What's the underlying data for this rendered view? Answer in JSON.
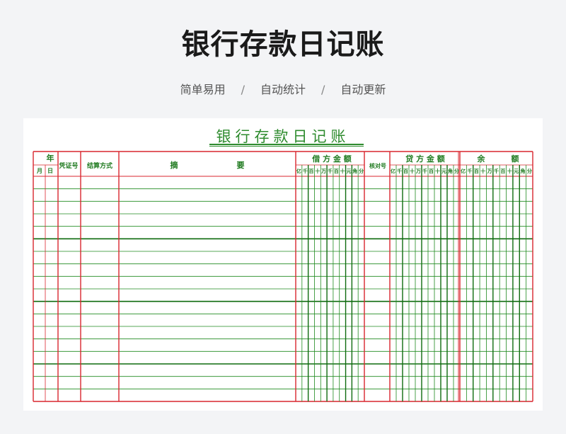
{
  "page": {
    "title": "银行存款日记账",
    "features": [
      "简单易用",
      "自动统计",
      "自动更新"
    ],
    "separator": "/"
  },
  "sheet": {
    "title": "银行存款日记账",
    "headers": {
      "year": "年",
      "month": "月",
      "day": "日",
      "voucher": "凭证号",
      "settlement": "结算方式",
      "summary_left": "摘",
      "summary_right": "要",
      "debit": "借 方 金 额",
      "check": "核对号",
      "credit": "贷 方 金 额",
      "balance_left": "余",
      "balance_right": "额"
    },
    "digit_units": [
      "亿",
      "千",
      "百",
      "十",
      "万",
      "千",
      "百",
      "十",
      "元",
      "角",
      "分"
    ],
    "body_rows": 18,
    "colors": {
      "red": "#d9262e",
      "green": "#1f8a1f",
      "dark_green": "#0f6b0f"
    }
  }
}
